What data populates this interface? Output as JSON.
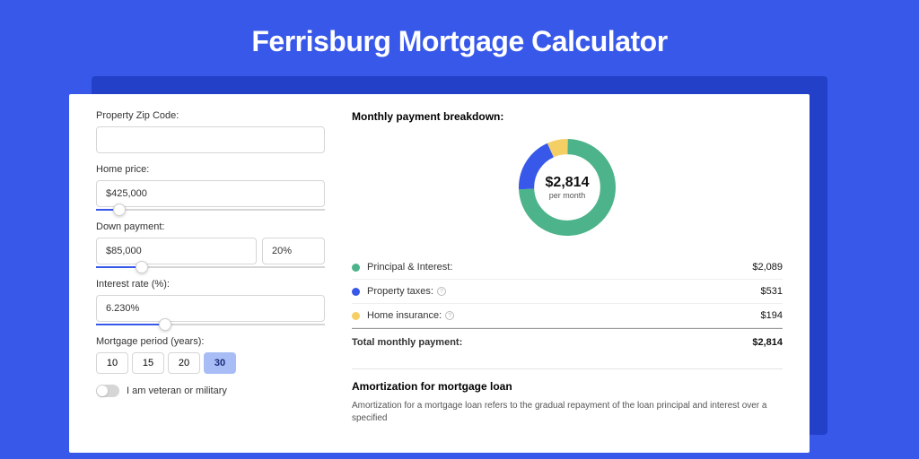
{
  "title": "Ferrisburg Mortgage Calculator",
  "form": {
    "zip_label": "Property Zip Code:",
    "zip_value": "",
    "home_price_label": "Home price:",
    "home_price_value": "$425,000",
    "home_price_slider_pct": 10,
    "down_payment_label": "Down payment:",
    "down_payment_value": "$85,000",
    "down_payment_pct": "20%",
    "down_payment_slider_pct": 20,
    "interest_label": "Interest rate (%):",
    "interest_value": "6.230%",
    "interest_slider_pct": 30,
    "period_label": "Mortgage period (years):",
    "periods": [
      "10",
      "15",
      "20",
      "30"
    ],
    "period_selected": "30",
    "veteran_label": "I am veteran or military"
  },
  "breakdown": {
    "title": "Monthly payment breakdown:",
    "center_value": "$2,814",
    "center_sub": "per month",
    "items": [
      {
        "label": "Principal & Interest:",
        "value": "$2,089",
        "color": "#4cb38a",
        "info": false
      },
      {
        "label": "Property taxes:",
        "value": "$531",
        "color": "#3858e9",
        "info": true
      },
      {
        "label": "Home insurance:",
        "value": "$194",
        "color": "#f4cf65",
        "info": true
      }
    ],
    "total_label": "Total monthly payment:",
    "total_value": "$2,814"
  },
  "chart_data": {
    "type": "pie",
    "title": "Monthly payment breakdown",
    "series": [
      {
        "name": "Principal & Interest",
        "value": 2089,
        "color": "#4cb38a"
      },
      {
        "name": "Property taxes",
        "value": 531,
        "color": "#3858e9"
      },
      {
        "name": "Home insurance",
        "value": 194,
        "color": "#f4cf65"
      }
    ],
    "total": 2814,
    "center_label": "$2,814 per month"
  },
  "amortization": {
    "title": "Amortization for mortgage loan",
    "text": "Amortization for a mortgage loan refers to the gradual repayment of the loan principal and interest over a specified"
  }
}
